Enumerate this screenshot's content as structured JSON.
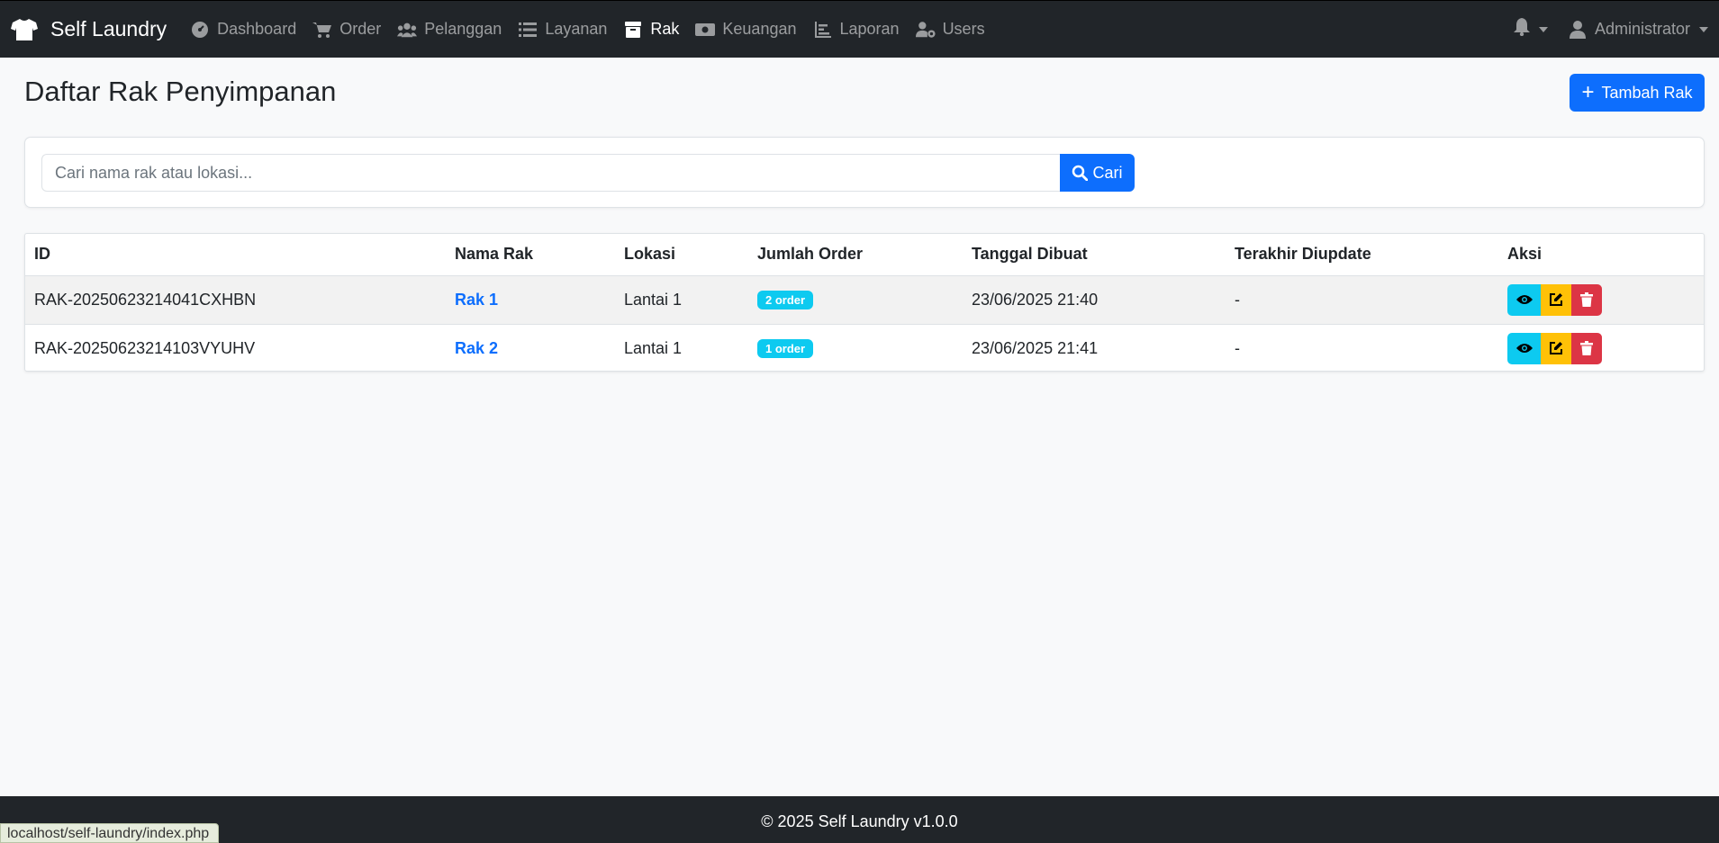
{
  "navbar": {
    "brand": "Self Laundry",
    "items": [
      {
        "label": "Dashboard",
        "icon": "gauge-icon",
        "active": false
      },
      {
        "label": "Order",
        "icon": "cart-icon",
        "active": false
      },
      {
        "label": "Pelanggan",
        "icon": "users-icon",
        "active": false
      },
      {
        "label": "Layanan",
        "icon": "list-icon",
        "active": false
      },
      {
        "label": "Rak",
        "icon": "box-icon",
        "active": true
      },
      {
        "label": "Keuangan",
        "icon": "money-icon",
        "active": false
      },
      {
        "label": "Laporan",
        "icon": "chart-icon",
        "active": false
      },
      {
        "label": "Users",
        "icon": "user-cog-icon",
        "active": false
      }
    ],
    "user": "Administrator"
  },
  "page": {
    "title": "Daftar Rak Penyimpanan",
    "add_button": "Tambah Rak"
  },
  "search": {
    "placeholder": "Cari nama rak atau lokasi...",
    "value": "",
    "button": "Cari"
  },
  "table": {
    "headers": [
      "ID",
      "Nama Rak",
      "Lokasi",
      "Jumlah Order",
      "Tanggal Dibuat",
      "Terakhir Diupdate",
      "Aksi"
    ],
    "rows": [
      {
        "id": "RAK-20250623214041CXHBN",
        "nama": "Rak 1",
        "lokasi": "Lantai 1",
        "jumlah": "2 order",
        "dibuat": "23/06/2025 21:40",
        "diupdate": "-"
      },
      {
        "id": "RAK-20250623214103VYUHV",
        "nama": "Rak 2",
        "lokasi": "Lantai 1",
        "jumlah": "1 order",
        "dibuat": "23/06/2025 21:41",
        "diupdate": "-"
      }
    ]
  },
  "footer": {
    "text": "© 2025 Self Laundry v1.0.0"
  },
  "status_bar": {
    "url": "localhost/self-laundry/index.php"
  },
  "colors": {
    "navbar": "#212529",
    "primary": "#0d6efd",
    "info": "#0dcaf0",
    "warning": "#ffc107",
    "danger": "#dc3545"
  }
}
